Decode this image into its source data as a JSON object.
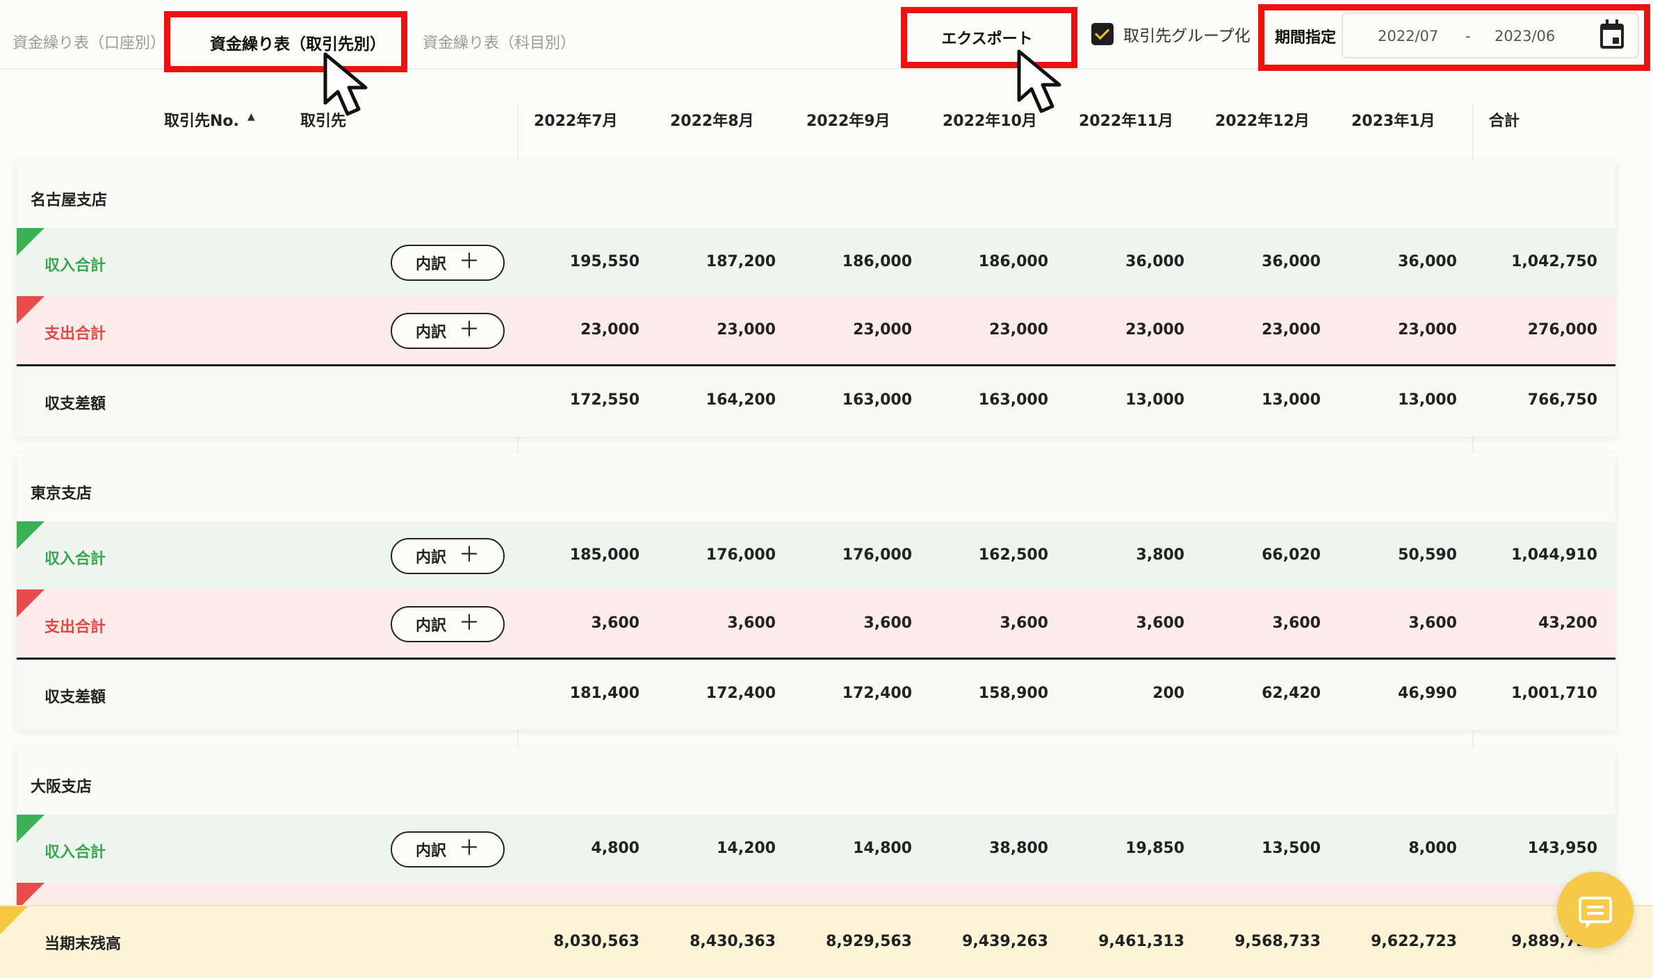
{
  "tabs": [
    {
      "label": "資金繰り表（口座別）",
      "active": false
    },
    {
      "label": "資金繰り表（取引先別）",
      "active": true
    },
    {
      "label": "資金繰り表（科目別）",
      "active": false
    }
  ],
  "toolbar": {
    "export_label": "エクスポート",
    "group_label": "取引先グループ化",
    "group_checked": true,
    "period_label": "期間指定",
    "period_from": "2022/07",
    "period_sep": "-",
    "period_to": "2023/06"
  },
  "colors": {
    "highlight": "#ee1111",
    "income": "#39a64f",
    "expense": "#e24747",
    "accent": "#f7c948"
  },
  "table": {
    "headers": {
      "partner_no": "取引先No.",
      "partner": "取引先",
      "months": [
        "2022年7月",
        "2022年8月",
        "2022年9月",
        "2022年10月",
        "2022年11月",
        "2022年12月",
        "2023年1月"
      ],
      "total": "合計"
    },
    "breakdown_label": "内訳",
    "sections": [
      {
        "name": "名古屋支店",
        "income_label": "収入合計",
        "income": [
          "195,550",
          "187,200",
          "186,000",
          "186,000",
          "36,000",
          "36,000",
          "36,000",
          "1,042,750"
        ],
        "expense_label": "支出合計",
        "expense": [
          "23,000",
          "23,000",
          "23,000",
          "23,000",
          "23,000",
          "23,000",
          "23,000",
          "276,000"
        ],
        "balance_label": "収支差額",
        "balance": [
          "172,550",
          "164,200",
          "163,000",
          "163,000",
          "13,000",
          "13,000",
          "13,000",
          "766,750"
        ]
      },
      {
        "name": "東京支店",
        "income_label": "収入合計",
        "income": [
          "185,000",
          "176,000",
          "176,000",
          "162,500",
          "3,800",
          "66,020",
          "50,590",
          "1,044,910"
        ],
        "expense_label": "支出合計",
        "expense": [
          "3,600",
          "3,600",
          "3,600",
          "3,600",
          "3,600",
          "3,600",
          "3,600",
          "43,200"
        ],
        "balance_label": "収支差額",
        "balance": [
          "181,400",
          "172,400",
          "172,400",
          "158,900",
          "200",
          "62,420",
          "46,990",
          "1,001,710"
        ]
      },
      {
        "name": "大阪支店",
        "income_label": "収入合計",
        "income": [
          "4,800",
          "14,200",
          "14,800",
          "38,800",
          "19,850",
          "13,500",
          "8,000",
          "143,950"
        ]
      }
    ],
    "ending_balance": {
      "label": "当期末残高",
      "values": [
        "8,030,563",
        "8,430,363",
        "8,929,563",
        "9,439,263",
        "9,461,313",
        "9,568,733",
        "9,622,723",
        "9,889,723"
      ]
    }
  }
}
